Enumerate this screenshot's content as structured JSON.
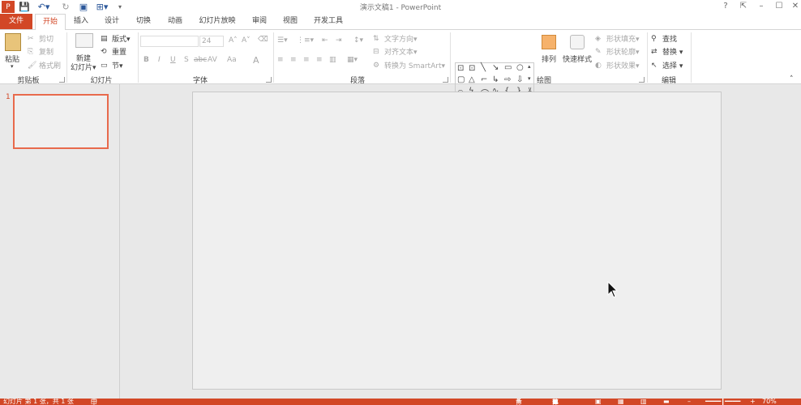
{
  "window": {
    "title": "演示文稿1 - PowerPoint",
    "controls": [
      "?",
      "⇱",
      "–",
      "☐",
      "✕"
    ]
  },
  "tabs": [
    "文件",
    "开始",
    "插入",
    "设计",
    "切换",
    "动画",
    "幻灯片放映",
    "审阅",
    "视图",
    "开发工具"
  ],
  "ribbon": {
    "clipboard": {
      "label": "剪贴板",
      "paste": "粘贴",
      "cut": "剪切",
      "copy": "复制",
      "format_painter": "格式刷"
    },
    "slides": {
      "label": "幻灯片",
      "new_slide_1": "新建",
      "new_slide_2": "幻灯片",
      "layout": "版式",
      "reset": "重置",
      "section": "节"
    },
    "font": {
      "label": "字体",
      "font_name": "",
      "font_size": "24",
      "bold": "B",
      "italic": "I",
      "underline": "U",
      "shadow": "S",
      "strike": "abc",
      "spacing": "AV",
      "case": "Aa",
      "color": "A"
    },
    "paragraph": {
      "label": "段落",
      "text_direction": "文字方向",
      "align_text": "对齐文本",
      "smartart": "转换为 SmartArt"
    },
    "drawing": {
      "label": "绘图",
      "arrange": "排列",
      "quick_styles": "快速样式",
      "shape_fill": "形状填充",
      "shape_outline": "形状轮廓",
      "shape_effects": "形状效果"
    },
    "editing": {
      "label": "编辑",
      "find": "查找",
      "replace": "替换",
      "select": "选择"
    }
  },
  "slides_pane": {
    "thumb_number": "1"
  },
  "status": {
    "left": "幻灯片 第 1 张，共 1 张",
    "lang": "中文(中国)",
    "notes": "备注",
    "comments": "批注",
    "zoom": "70%"
  },
  "colors": {
    "accent": "#d24726",
    "title_blue": "#2b579a"
  }
}
